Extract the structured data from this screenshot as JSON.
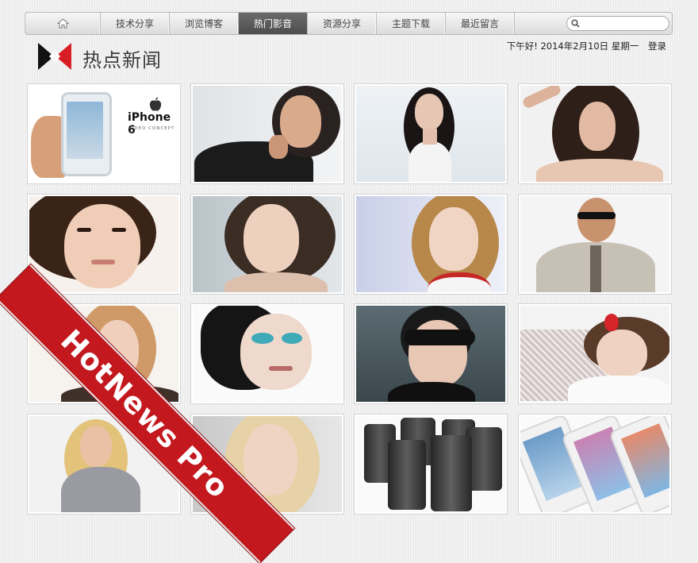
{
  "nav": {
    "home_icon": "home-icon",
    "tabs": [
      {
        "label": "技术分享",
        "active": false
      },
      {
        "label": "浏览博客",
        "active": false
      },
      {
        "label": "热门影音",
        "active": true
      },
      {
        "label": "资源分享",
        "active": false
      },
      {
        "label": "主题下载",
        "active": false
      },
      {
        "label": "最近留言",
        "active": false
      }
    ],
    "search": {
      "value": "",
      "icon": "search-icon"
    }
  },
  "header": {
    "logo_text": "热点新闻",
    "greeting": "下午好! 2014年2月10日 星期一",
    "login": "登录"
  },
  "gallery": {
    "iphone_caption": "iPhone 6",
    "iphone_sub": "VIDEO CONCEPT"
  },
  "ribbon": {
    "text": "HotNews Pro"
  },
  "colors": {
    "accent": "#c3181e",
    "nav_active": "#585858",
    "logo_black": "#111111"
  }
}
